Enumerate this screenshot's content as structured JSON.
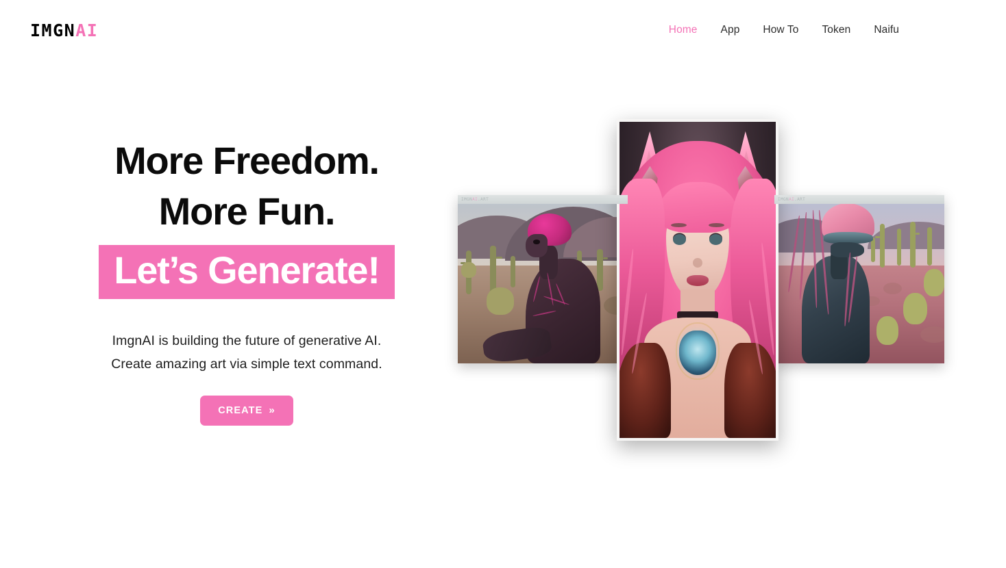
{
  "brand": {
    "logo_primary": "IMGN",
    "logo_accent": "AI",
    "accent_color": "#F472B6"
  },
  "nav": {
    "items": [
      {
        "label": "Home",
        "active": true
      },
      {
        "label": "App",
        "active": false
      },
      {
        "label": "How To",
        "active": false
      },
      {
        "label": "Token",
        "active": false
      },
      {
        "label": "Naifu",
        "active": false
      }
    ]
  },
  "hero": {
    "headline_line1": "More Freedom.",
    "headline_line2": "More Fun.",
    "headline_highlight": "Let’s Generate!",
    "subtitle_line1": "ImgnAI is building the future of generative AI.",
    "subtitle_line2": "Create amazing art via simple text command.",
    "cta_label": "CREATE",
    "cta_icon": "double-chevron-right-icon",
    "highlight_bg": "#F472B6",
    "highlight_text": "#FFFFFF"
  },
  "gallery": {
    "watermark": {
      "primary": "IMGN",
      "accent": "AI",
      "suffix": ".ART"
    },
    "cards": [
      {
        "position": "left",
        "alt": "AI generated pink-brained alien seated in a cactus desert with mountains"
      },
      {
        "position": "center",
        "alt": "AI generated woman with pink hair and cat ears wearing a jeweled pendant"
      },
      {
        "position": "right",
        "alt": "AI generated cyborg alien with pink helmet standing in a pink cactus desert"
      }
    ]
  }
}
